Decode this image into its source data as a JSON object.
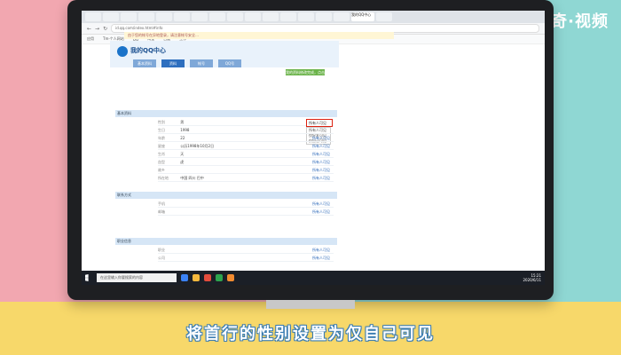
{
  "brand": {
    "watermark": "天奇·视频"
  },
  "caption": "将首行的性别设置为仅自己可见",
  "browser": {
    "url": "id.qq.com/index.html#info",
    "tabs": [
      "",
      "",
      "",
      "",
      "",
      "",
      "",
      "",
      "",
      "",
      "",
      "",
      "",
      "",
      "",
      "",
      ""
    ],
    "active_tab": "我的QQ中心",
    "bookmarks": [
      "应用",
      "Tm-个人网站",
      "QQ",
      "淘宝",
      "百度",
      "工作"
    ]
  },
  "notice": "由于您的帐号在异地登录，请注意帐号安全…",
  "qq_center": {
    "logo_text": "我的QQ中心",
    "nav": [
      "基本资料",
      "资料",
      "帐号",
      "QQ号"
    ],
    "green_button": "我的资料修改完成，点击保存",
    "sections": [
      {
        "name": "基本资料",
        "rows": [
          {
            "k": "性别",
            "v": "男",
            "visibility": "所有人可见"
          },
          {
            "k": "生日",
            "v": "1998",
            "visibility": "所有人可见"
          },
          {
            "k": "年龄",
            "v": "22",
            "visibility": "所有人可见"
          },
          {
            "k": "星座",
            "v": "公历1998年10月2日",
            "visibility": "所有人可见"
          },
          {
            "k": "生肖",
            "v": "天",
            "visibility": "所有人可见"
          },
          {
            "k": "血型",
            "v": "虎",
            "visibility": "所有人可见"
          },
          {
            "k": "故乡",
            "v": "",
            "visibility": "所有人可见"
          },
          {
            "k": "所在地",
            "v": "中国 四川 巴中",
            "visibility": "所有人可见"
          }
        ]
      },
      {
        "name": "联系方式",
        "rows": [
          {
            "k": "手机",
            "v": "",
            "visibility": "所有人可见"
          },
          {
            "k": "邮箱",
            "v": "",
            "visibility": "所有人可见"
          }
        ]
      },
      {
        "name": "职业信息",
        "rows": [
          {
            "k": "职业",
            "v": "",
            "visibility": "所有人可见"
          },
          {
            "k": "公司",
            "v": "",
            "visibility": "所有人可见"
          }
        ]
      }
    ],
    "select_current": "所有人可见",
    "dropdown_options": [
      "所有人可见",
      "仅好友可见",
      "仅自己可见"
    ]
  },
  "taskbar": {
    "search_placeholder": "在这里输入你要搜索的内容",
    "time": "15:21",
    "date": "2020/6/11"
  }
}
